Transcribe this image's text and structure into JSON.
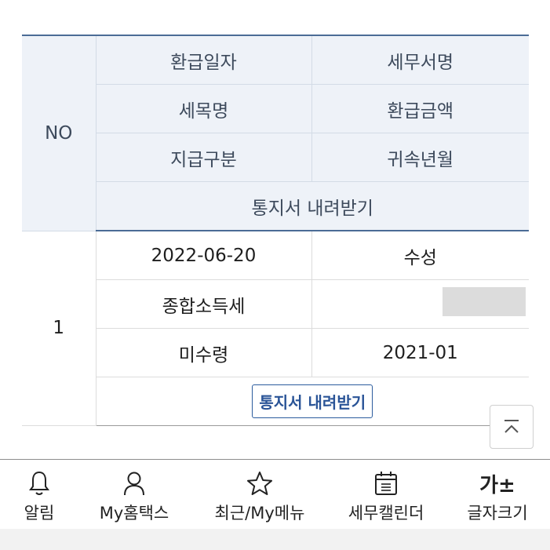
{
  "table": {
    "header": {
      "no": "NO",
      "refund_date": "환급일자",
      "tax_office": "세무서명",
      "tax_item": "세목명",
      "refund_amount": "환급금액",
      "payment_type": "지급구분",
      "attribution_month": "귀속년월",
      "download": "통지서 내려받기"
    },
    "rows": [
      {
        "no": "1",
        "refund_date": "2022-06-20",
        "tax_office": "수성",
        "tax_item": "종합소득세",
        "refund_amount": "",
        "payment_type": "미수령",
        "attribution_month": "2021-01",
        "download_button": "통지서 내려받기"
      }
    ]
  },
  "scroll_top_icon": "chevron-up-icon",
  "bottom_nav": {
    "items": [
      {
        "label": "알림",
        "icon": "bell-icon"
      },
      {
        "label": "My홈택스",
        "icon": "person-icon"
      },
      {
        "label": "최근/My메뉴",
        "icon": "star-icon"
      },
      {
        "label": "세무캘린더",
        "icon": "calendar-icon"
      },
      {
        "label": "글자크기",
        "icon": "font-size-icon",
        "glyph": "가±"
      }
    ]
  },
  "colors": {
    "header_bg": "#eef2f8",
    "accent_line": "#4b6c96",
    "button_border": "#2b5c9e"
  }
}
